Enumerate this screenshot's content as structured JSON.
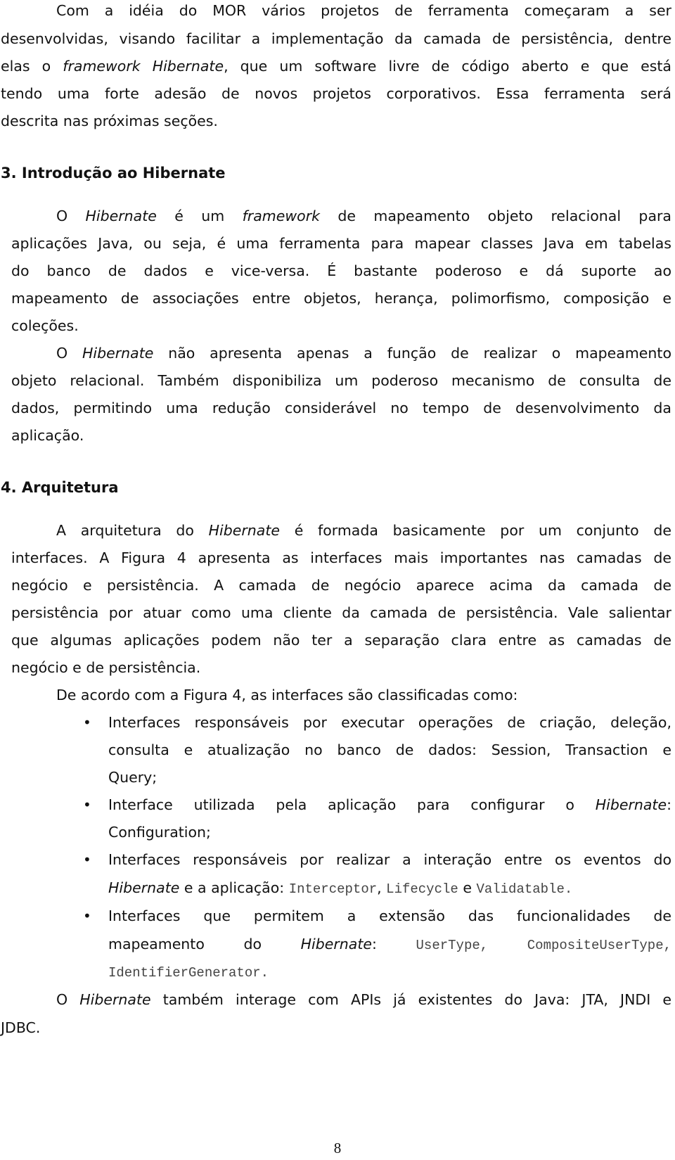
{
  "intro": {
    "lines": [
      "Com a idéia do MOR vários projetos de ferramenta começaram a ser",
      "desenvolvidas, visando facilitar a implementação da camada de persistência, dentre",
      [
        "elas o ",
        "framework Hibernate",
        ", que um software livre de código aberto e que está"
      ],
      "tendo uma forte adesão de novos projetos corporativos. Essa ferramenta será",
      "descrita nas próximas seções."
    ]
  },
  "section3": {
    "heading": "3. Introdução ao Hibernate",
    "p1": {
      "l1": [
        "O ",
        "Hibernate",
        " é um ",
        "framework",
        " de mapeamento objeto relacional para"
      ],
      "l2": "aplicações Java, ou seja, é uma ferramenta para mapear classes Java em tabelas",
      "l3": "do banco de dados e vice-versa. É bastante poderoso e dá suporte ao",
      "l4": "mapeamento de associações entre objetos, herança, polimorfismo, composição e",
      "l5": "coleções."
    },
    "p2": {
      "l1": [
        "O ",
        "Hibernate",
        " não apresenta apenas a função de realizar o mapeamento"
      ],
      "l2": "objeto relacional. Também disponibiliza um poderoso mecanismo de consulta de",
      "l3": "dados, permitindo uma redução considerável no tempo de desenvolvimento da",
      "l4": "aplicação."
    }
  },
  "section4": {
    "heading": "4. Arquitetura",
    "p1": {
      "l1": [
        "A arquitetura do ",
        "Hibernate",
        " é formada basicamente por um conjunto de"
      ],
      "l2": "interfaces. A Figura 4 apresenta as interfaces mais importantes nas camadas de",
      "l3": "negócio e persistência. A camada de negócio aparece acima da camada de",
      "l4": "persistência por atuar como uma cliente da camada de persistência. Vale salientar",
      "l5": "que algumas aplicações podem não ter a separação clara entre as camadas de",
      "l6": "negócio e de persistência."
    },
    "p2": "De acordo com a Figura 4, as interfaces são classificadas como:",
    "bullets": [
      {
        "l1": "Interfaces responsáveis por executar operações de criação, deleção,",
        "l2": "consulta e atualização no banco de dados: Session, Transaction e",
        "l3": "Query;"
      },
      {
        "l1": [
          "Interface utilizada pela aplicação para configurar o ",
          "Hibernate",
          ":"
        ],
        "l2": "Configuration;"
      },
      {
        "l1": "Interfaces responsáveis por realizar a interação entre os eventos do",
        "l2": [
          "Hibernate",
          " e a aplicação: ",
          "Interceptor",
          ", ",
          "Lifecycle",
          " e ",
          "Validatable",
          "."
        ]
      },
      {
        "l1": "Interfaces que permitem a extensão das funcionalidades de",
        "l2": [
          "mapeamento do ",
          "Hibernate",
          ": ",
          "UserType,",
          "CompositeUserType,"
        ],
        "l3": "IdentifierGenerator."
      }
    ],
    "p3": {
      "l1": [
        "O ",
        "Hibernate",
        " também interage com APIs já existentes do Java: JTA, JNDI e"
      ],
      "l2": "JDBC."
    }
  },
  "page_number": "8"
}
